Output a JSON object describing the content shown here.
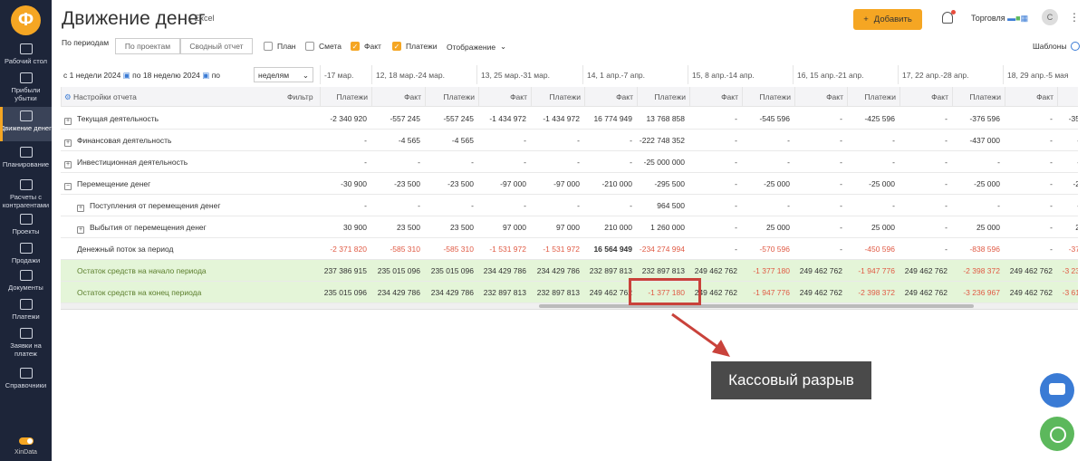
{
  "sidebar": {
    "items": [
      "Рабочий стол",
      "Прибыли убытки",
      "Движение денег",
      "Планирование",
      "Расчеты с контрагентами",
      "Проекты",
      "Продажи",
      "Документы",
      "Платежи",
      "Заявки на платеж",
      "Справочники"
    ],
    "brand": "XinData"
  },
  "header": {
    "title": "Движение денег",
    "excel": "Excel",
    "add": "Добавить",
    "company": "Торговля",
    "avatar": "С"
  },
  "toolbar": {
    "periods": "По периодам",
    "projects": "По проектам",
    "summary": "Сводный отчет",
    "plan": "План",
    "estimate": "Смета",
    "fact": "Факт",
    "payments": "Платежи",
    "display": "Отображение",
    "templates": "Шаблоны"
  },
  "filters": {
    "from": "с",
    "from_val": "1 недели 2024",
    "to": "по",
    "to_val": "18 неделю 2024",
    "by": "по",
    "period": "неделям"
  },
  "grid": {
    "settings": "Настройки отчета",
    "filter": "Фильтр",
    "weeks": [
      "-17 мар.",
      "12, 18 мар.-24 мар.",
      "13, 25 мар.-31 мар.",
      "14, 1 апр.-7 апр.",
      "15, 8 апр.-14 апр.",
      "16, 15 апр.-21 апр.",
      "17, 22 апр.-28 апр.",
      "18, 29 апр.-5 мая"
    ],
    "subheaders": [
      "Платежи",
      "Факт",
      "Платежи",
      "Факт",
      "Платежи",
      "Факт",
      "Платежи",
      "Факт",
      "Платежи",
      "Факт",
      "Платежи",
      "Факт",
      "Платежи",
      "Факт",
      ""
    ],
    "rows": [
      {
        "label": "Текущая деятельность",
        "icon": "+",
        "values": [
          "-2 340 920",
          "-557 245",
          "-557 245",
          "-1 434 972",
          "-1 434 972",
          "16 774 949",
          "13 768 858",
          "-",
          "-545 596",
          "-",
          "-425 596",
          "-",
          "-376 596",
          "-",
          "-35"
        ]
      },
      {
        "label": "Финансовая деятельность",
        "icon": "+",
        "values": [
          "-",
          "-4 565",
          "-4 565",
          "-",
          "-",
          "-",
          "-222 748 352",
          "-",
          "-",
          "-",
          "-",
          "-",
          "-437 000",
          "-",
          "-"
        ]
      },
      {
        "label": "Инвестиционная деятельность",
        "icon": "+",
        "values": [
          "-",
          "-",
          "-",
          "-",
          "-",
          "-",
          "-25 000 000",
          "-",
          "-",
          "-",
          "-",
          "-",
          "-",
          "-",
          "-"
        ]
      },
      {
        "label": "Перемещение денег",
        "icon": "−",
        "values": [
          "-30 900",
          "-23 500",
          "-23 500",
          "-97 000",
          "-97 000",
          "-210 000",
          "-295 500",
          "-",
          "-25 000",
          "-",
          "-25 000",
          "-",
          "-25 000",
          "-",
          "-2"
        ]
      },
      {
        "label": "Поступления от перемещения денег",
        "icon": "+",
        "values": [
          "-",
          "-",
          "-",
          "-",
          "-",
          "-",
          "964 500",
          "-",
          "-",
          "-",
          "-",
          "-",
          "-",
          "-",
          "-"
        ]
      },
      {
        "label": "Выбытия от перемещения денег",
        "icon": "+",
        "values": [
          "30 900",
          "23 500",
          "23 500",
          "97 000",
          "97 000",
          "210 000",
          "1 260 000",
          "-",
          "25 000",
          "-",
          "25 000",
          "-",
          "25 000",
          "-",
          "2"
        ]
      },
      {
        "label": "Денежный поток за период",
        "icon": "",
        "values": [
          "-2 371 820",
          "-585 310",
          "-585 310",
          "-1 531 972",
          "-1 531 972",
          "16 564 949",
          "-234 274 994",
          "-",
          "-570 596",
          "-",
          "-450 596",
          "-",
          "-838 596",
          "-",
          "-37"
        ]
      },
      {
        "label": "Остаток средств на начало периода",
        "icon": "",
        "values": [
          "237 386 915",
          "235 015 096",
          "235 015 096",
          "234 429 786",
          "234 429 786",
          "232 897 813",
          "232 897 813",
          "249 462 762",
          "-1 377 180",
          "249 462 762",
          "-1 947 776",
          "249 462 762",
          "-2 398 372",
          "249 462 762",
          "-3 23"
        ]
      },
      {
        "label": "Остаток средств на конец периода",
        "icon": "",
        "values": [
          "235 015 096",
          "234 429 786",
          "234 429 786",
          "232 897 813",
          "232 897 813",
          "249 462 762",
          "-1 377 180",
          "249 462 762",
          "-1 947 776",
          "249 462 762",
          "-2 398 372",
          "249 462 762",
          "-3 236 967",
          "249 462 762",
          "-3 61"
        ]
      }
    ]
  },
  "annotation": {
    "text": "Кассовый разрыв"
  },
  "colors": {
    "accent": "#f5a623",
    "sidebar": "#1d2539",
    "negative": "#e05a44",
    "green_row": "#e4f5d8",
    "callout": "#c9423b"
  }
}
